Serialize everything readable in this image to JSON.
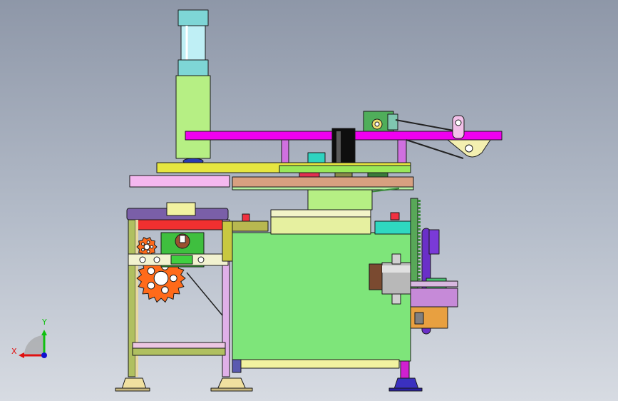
{
  "viewport": {
    "background_top": "#8e97a8",
    "background_bottom": "#d7dbe2"
  },
  "triad": {
    "x_label": "X",
    "y_label": "Y",
    "x_color": "#e01010",
    "y_color": "#10c010",
    "z_color": "#1010d0"
  },
  "colors": {
    "frame_green": "#7ee57a",
    "magenta_beam": "#f000f0",
    "lavender": "#cfa6d8",
    "gear_orange": "#ff6a1a",
    "belt_purple": "#6a2fc8",
    "cyan_glass": "#8ed8e6",
    "yellow": "#f0f07a",
    "black_roller": "#101010"
  }
}
